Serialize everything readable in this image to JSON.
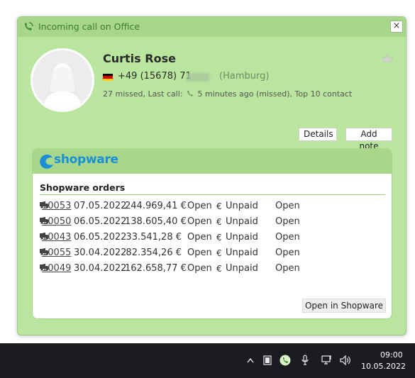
{
  "popup": {
    "title": "Incoming call on Office",
    "close_label": "×"
  },
  "contact": {
    "name": "Curtis Rose",
    "phone": "+49 (15678) 71",
    "location": "(Hamburg)",
    "stats_prefix": "27 missed, Last call:",
    "stats_suffix": "5 minutes ago (missed), Top 10 contact",
    "flag": "de-flag-icon"
  },
  "actions": {
    "details": "Details",
    "add_note": "Add note"
  },
  "shopware": {
    "logo": "shopware",
    "orders_title": "Shopware orders",
    "open_button": "Open in Shopware",
    "orders": [
      {
        "id": "10053",
        "date": "07.05.2022",
        "amount": "244.969,41 €",
        "status": "Open",
        "payment": "Unpaid",
        "shipping": "Open"
      },
      {
        "id": "10050",
        "date": "06.05.2022",
        "amount": "138.605,40 €",
        "status": "Open",
        "payment": "Unpaid",
        "shipping": "Open"
      },
      {
        "id": "10043",
        "date": "06.05.2022",
        "amount": "33.541,28 €",
        "status": "Open",
        "payment": "Unpaid",
        "shipping": "Open"
      },
      {
        "id": "10055",
        "date": "30.04.2022",
        "amount": "82.354,26 €",
        "status": "Open",
        "payment": "Unpaid",
        "shipping": "Open"
      },
      {
        "id": "10049",
        "date": "30.04.2022",
        "amount": "162.658,77 €",
        "status": "Open",
        "payment": "Unpaid",
        "shipping": "Open"
      }
    ]
  },
  "taskbar": {
    "time": "09:00",
    "date": "10.05.2022"
  },
  "colors": {
    "popup_bg": "#b9e59e",
    "accent": "#a8d78c",
    "shopware_blue": "#1a8fd6"
  }
}
